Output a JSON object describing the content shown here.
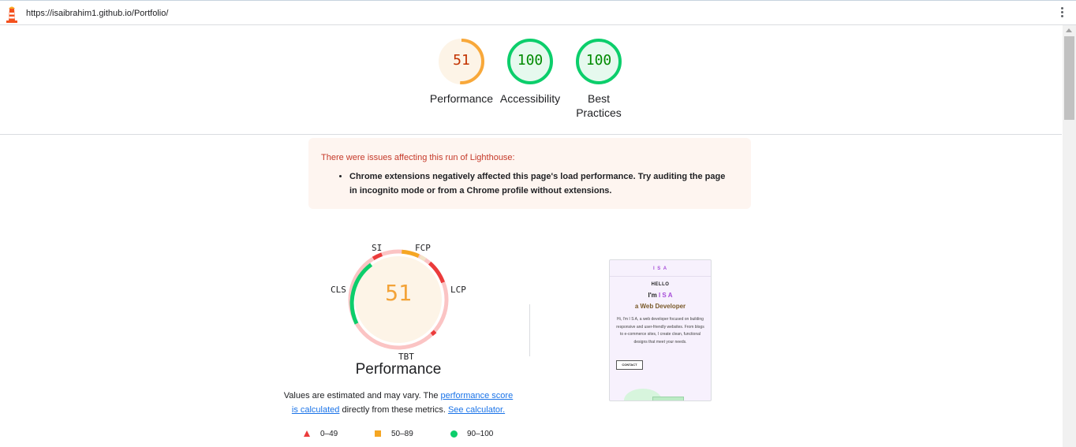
{
  "browser": {
    "url": "https://isaibrahim1.github.io/Portfolio/"
  },
  "scores": {
    "performance": {
      "value": "51",
      "label": "Performance",
      "fraction": 0.51,
      "color": "#ffa400"
    },
    "accessibility": {
      "value": "100",
      "label": "Accessibility",
      "fraction": 1.0,
      "color": "#0cce6b"
    },
    "best_practices": {
      "value": "100",
      "label": "Best Practices",
      "fraction": 1.0,
      "color": "#0cce6b"
    }
  },
  "warning": {
    "title": "There were issues affecting this run of Lighthouse:",
    "item": "Chrome extensions negatively affected this page's load performance. Try auditing the page in incognito mode or from a Chrome profile without extensions."
  },
  "performance_detail": {
    "score": "51",
    "title": "Performance",
    "metrics": [
      "SI",
      "FCP",
      "LCP",
      "TBT",
      "CLS"
    ],
    "note_prefix": "Values are estimated and may vary. The ",
    "note_link1": "performance score is calculated",
    "note_middle": " directly from these metrics. ",
    "note_link2": "See calculator."
  },
  "legend": [
    {
      "label": "0–49",
      "color": "#eb3b3b"
    },
    {
      "label": "50–89",
      "color": "#f5a623"
    },
    {
      "label": "90–100",
      "color": "#0cce6b"
    }
  ],
  "preview": {
    "brand": "I S A",
    "hello": "HELLO",
    "im_prefix": "I'm ",
    "im_name": "I S A",
    "role": "a Web Developer",
    "description": "Hi, I'm I S A, a web developer focused on building responsive and user-friendly websites. From blogs to e-commerce sites, I create clean, functional designs that meet your needs.",
    "button": "CONTACT"
  }
}
